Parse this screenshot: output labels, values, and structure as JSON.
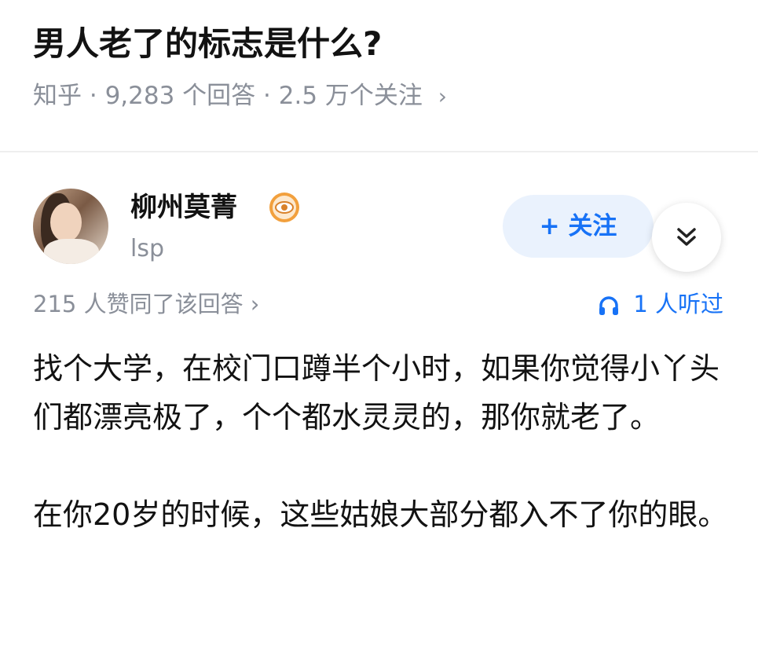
{
  "question": {
    "title": "男人老了的标志是什么?",
    "source": "知乎",
    "answers_count": "9,283 个回答",
    "followers": "2.5 万个关注"
  },
  "answer": {
    "author": {
      "name": "柳州莫菁",
      "description": "lsp",
      "avatar_icon": "user-avatar",
      "badge_icon": "eye-badge-icon"
    },
    "follow_label": "+ 关注",
    "more_icon": "double-chevron-down-icon",
    "votes_text": "215 人赞同了该回答",
    "listeners_text": "1 人听过",
    "listen_icon": "headphones-icon",
    "paragraphs": [
      "找个大学，在校门口蹲半个小时，如果你觉得小丫头们都漂亮极了，个个都水灵灵的，那你就老了。",
      "在你20岁的时候，这些姑娘大部分都入不了你的眼。"
    ]
  },
  "colors": {
    "accent": "#1772f6",
    "muted": "#8a8f99",
    "badge": "#f2a03d"
  }
}
